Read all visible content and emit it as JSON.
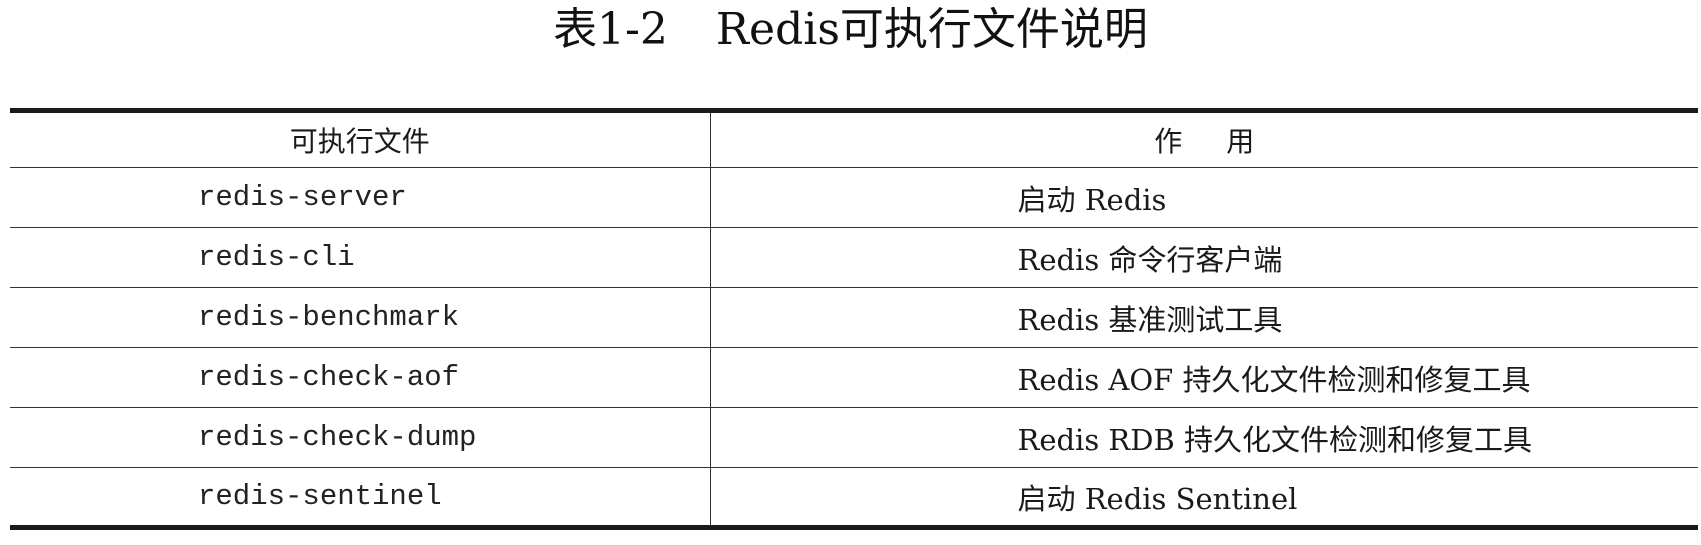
{
  "caption": {
    "number": "表1-2",
    "title": "Redis可执行文件说明"
  },
  "table": {
    "headers": {
      "executable": "可执行文件",
      "purpose": "作用"
    },
    "rows": [
      {
        "executable": "redis-server",
        "purpose": "启动 Redis"
      },
      {
        "executable": "redis-cli",
        "purpose": "Redis 命令行客户端"
      },
      {
        "executable": "redis-benchmark",
        "purpose": "Redis 基准测试工具"
      },
      {
        "executable": "redis-check-aof",
        "purpose": "Redis AOF 持久化文件检测和修复工具"
      },
      {
        "executable": "redis-check-dump",
        "purpose": "Redis RDB 持久化文件检测和修复工具"
      },
      {
        "executable": "redis-sentinel",
        "purpose": "启动 Redis Sentinel"
      }
    ]
  }
}
